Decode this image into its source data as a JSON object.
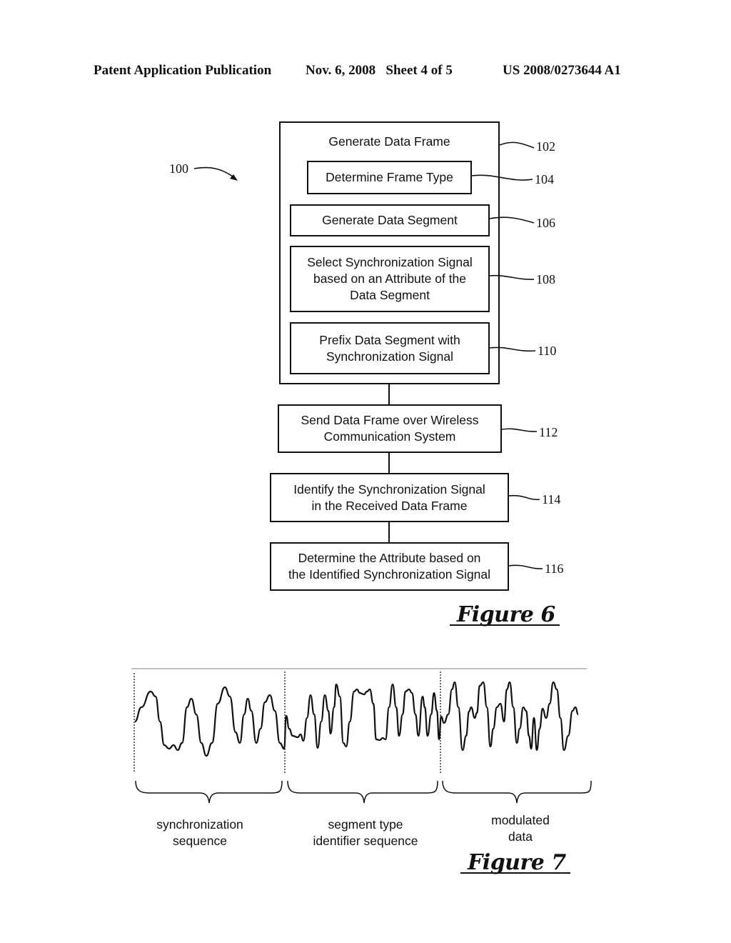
{
  "header": {
    "publication": "Patent Application Publication",
    "date_sheet": "Nov. 6, 2008   Sheet 4 of 5",
    "number": "US 2008/0273644 A1"
  },
  "figure6": {
    "caption": "Figure 6",
    "method_ref": "100",
    "outer": {
      "label": "Generate Data Frame",
      "ref": "102"
    },
    "steps": [
      {
        "id": "104",
        "label": "Determine Frame Type"
      },
      {
        "id": "106",
        "label": "Generate Data Segment"
      },
      {
        "id": "108",
        "label": "Select Synchronization Signal\nbased on an Attribute of the\nData Segment"
      },
      {
        "id": "110",
        "label": "Prefix Data Segment with\nSynchronization Signal"
      },
      {
        "id": "112",
        "label": "Send Data Frame over Wireless\nCommunication System"
      },
      {
        "id": "114",
        "label": "Identify the Synchronization Signal\nin the Received Data Frame"
      },
      {
        "id": "116",
        "label": "Determine the Attribute based on\nthe Identified Synchronization Signal"
      }
    ]
  },
  "figure7": {
    "caption": "Figure 7",
    "segments": [
      {
        "label": "synchronization\nsequence"
      },
      {
        "label": "segment type\nidentifier sequence"
      },
      {
        "label": "modulated\ndata"
      }
    ]
  }
}
